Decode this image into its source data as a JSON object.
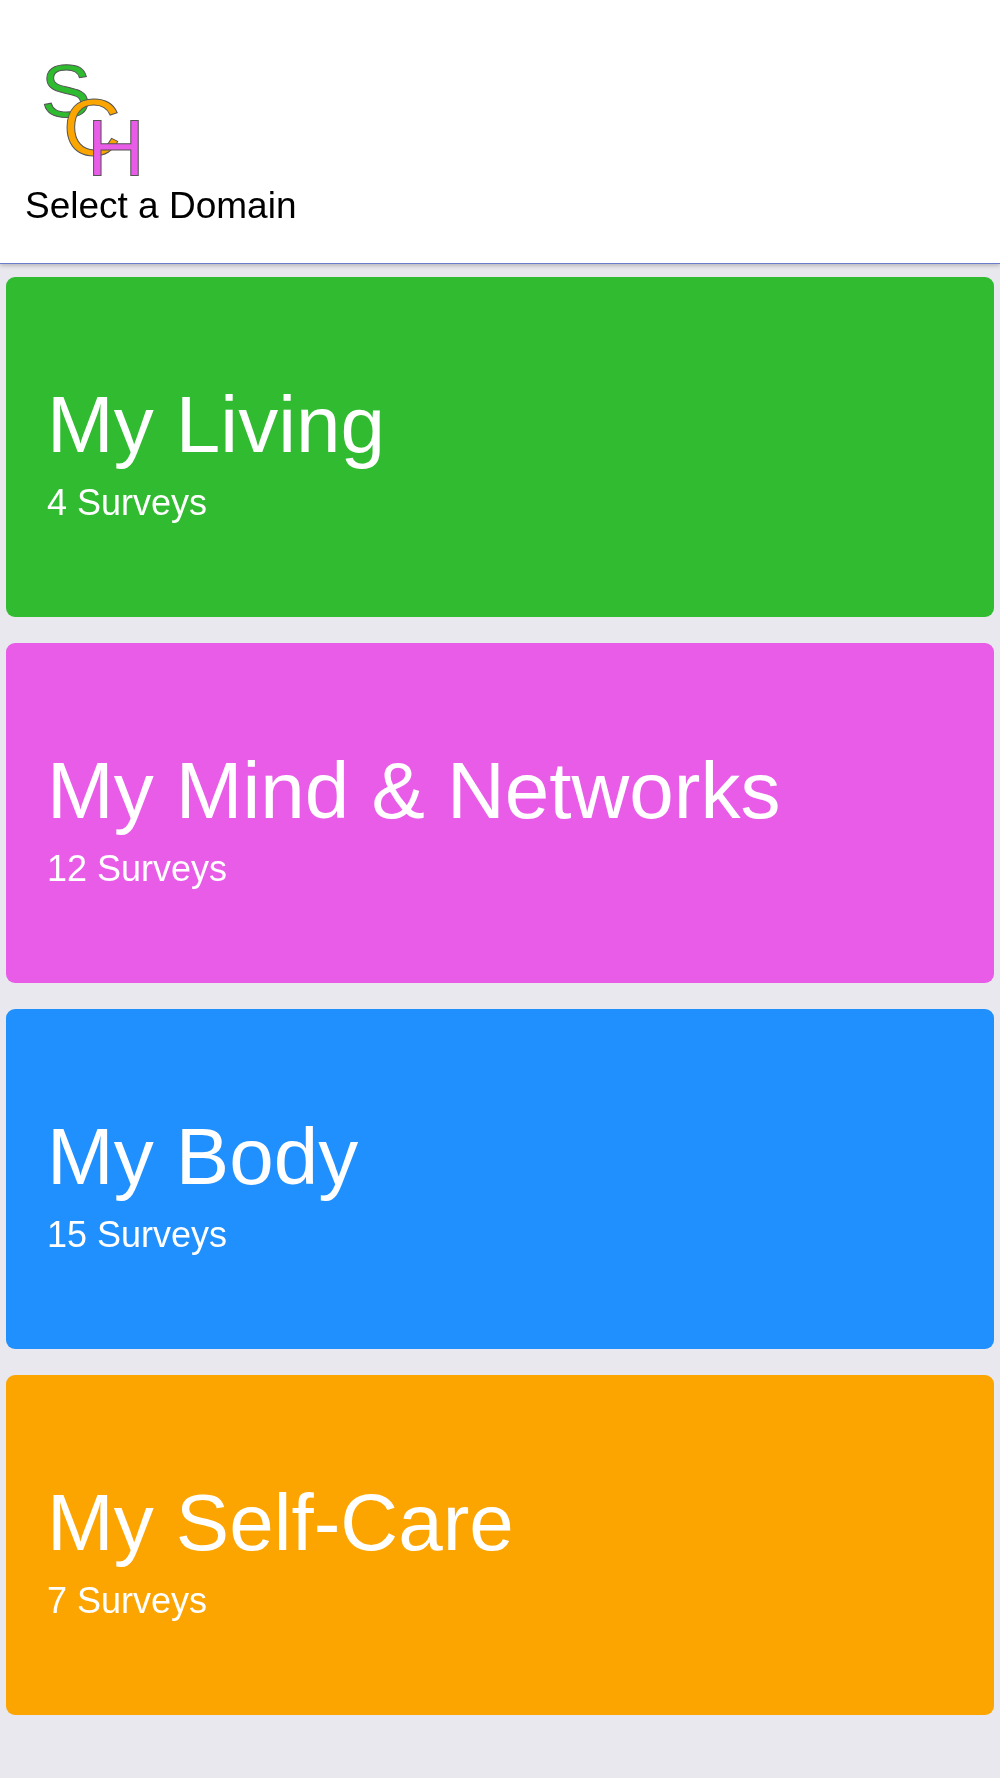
{
  "header": {
    "logo": [
      {
        "letter": "S",
        "color": "#2fbb2f"
      },
      {
        "letter": "C",
        "color": "#fba500"
      },
      {
        "letter": "H",
        "color": "#e85ce8"
      }
    ],
    "title": "Select a Domain"
  },
  "domains": [
    {
      "name": "My Living",
      "count": "4 Surveys",
      "color": "#30bb30"
    },
    {
      "name": "My Mind & Networks",
      "count": "12 Surveys",
      "color": "#e85ce8"
    },
    {
      "name": "My Body",
      "count": "15 Surveys",
      "color": "#2090ff"
    },
    {
      "name": "My Self-Care",
      "count": "7 Surveys",
      "color": "#fca400"
    }
  ]
}
